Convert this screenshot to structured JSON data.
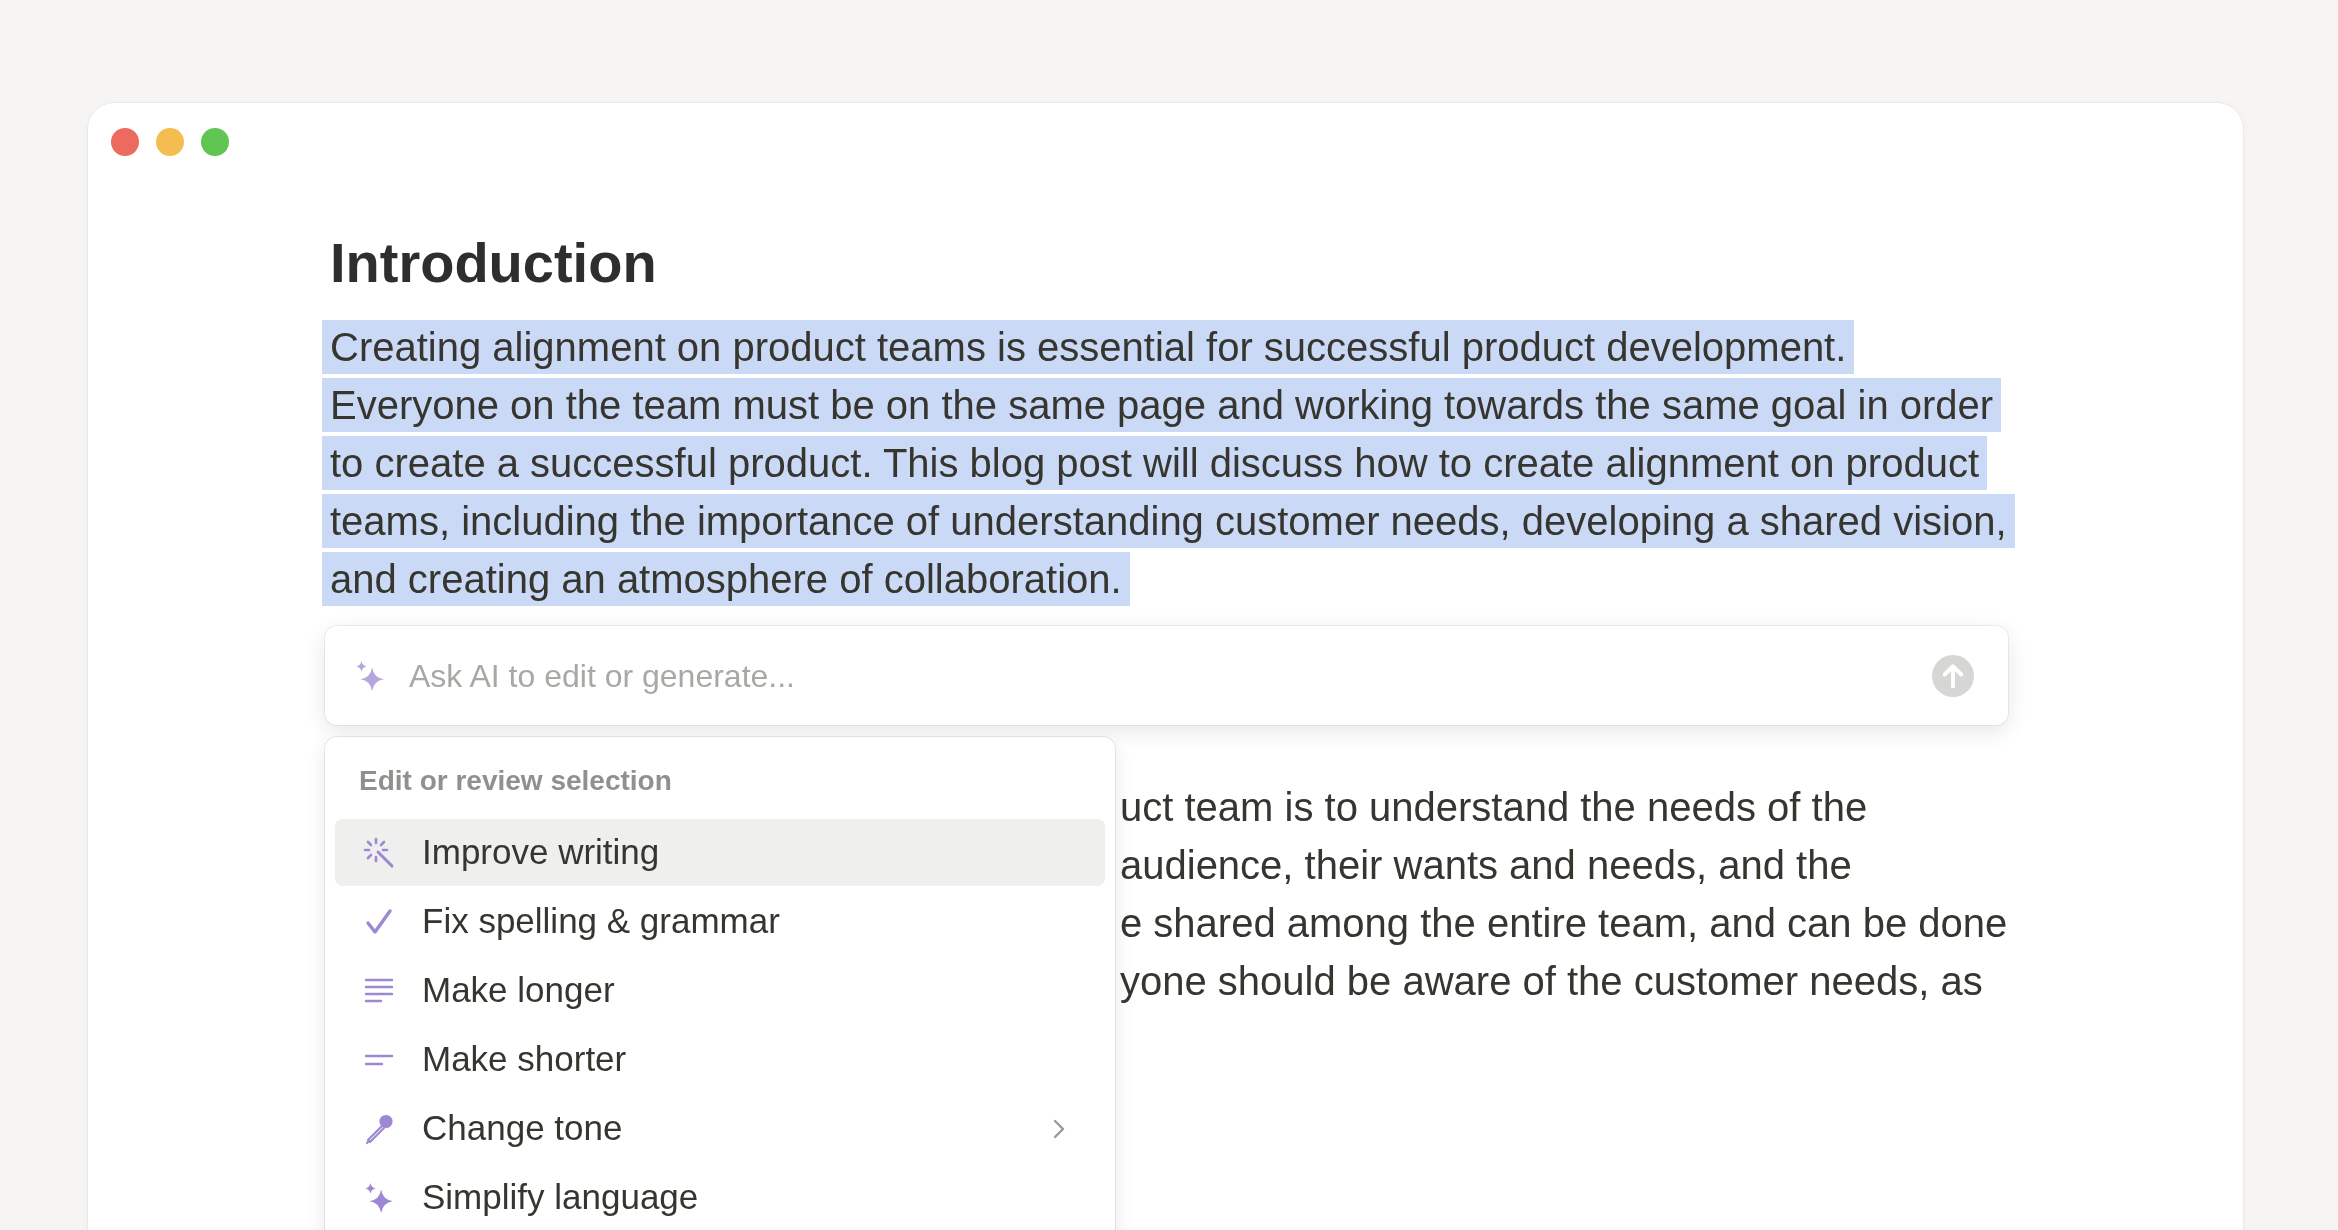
{
  "document": {
    "heading": "Introduction",
    "paragraph": {
      "text": "Creating alignment on product teams is essential for successful product development. Everyone on the team must be on the same page and working towards the same goal in order to create a successful product. This blog post will discuss how to create alignment on product teams, including the importance of understanding customer needs, developing a shared vision, and creating an atmosphere of collaboration.",
      "selected": true
    },
    "body_lines": [
      "uct team is to understand the needs of the",
      "audience, their wants and needs, and the",
      "e shared among the entire team, and can be done",
      "yone should be aware of the customer needs, as"
    ]
  },
  "ai_prompt": {
    "placeholder": "Ask AI to edit or generate..."
  },
  "menu": {
    "section_title": "Edit or review selection",
    "items": [
      {
        "label": "Improve writing",
        "selected": true,
        "submenu": false
      },
      {
        "label": "Fix spelling & grammar",
        "selected": false,
        "submenu": false
      },
      {
        "label": "Make longer",
        "selected": false,
        "submenu": false
      },
      {
        "label": "Make shorter",
        "selected": false,
        "submenu": false
      },
      {
        "label": "Change tone",
        "selected": false,
        "submenu": true
      },
      {
        "label": "Simplify language",
        "selected": false,
        "submenu": false
      }
    ]
  }
}
